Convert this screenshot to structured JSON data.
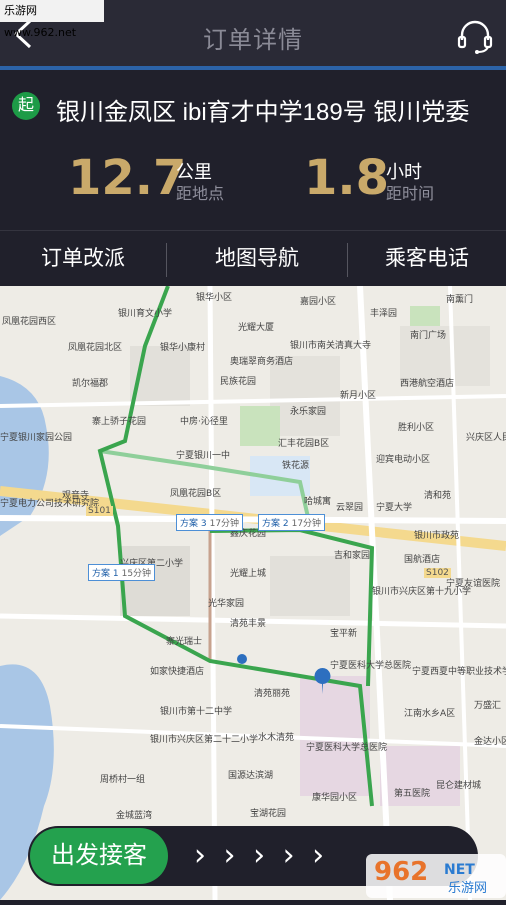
{
  "watermark_top": "乐游网 www.962.net",
  "header": {
    "title": "订单详情"
  },
  "order": {
    "start_badge": "起",
    "address": "银川金凤区 ibi育才中学189号 银川党委",
    "distance": {
      "value": "12.7",
      "unit": "公里",
      "label": "距地点"
    },
    "duration": {
      "value": "1.8",
      "unit": "小时",
      "label": "距时间"
    }
  },
  "actions": {
    "reassign": "订单改派",
    "navigate": "地图导航",
    "call": "乘客电话"
  },
  "map": {
    "labels": [
      "银华小区",
      "嘉园小区",
      "南薰门",
      "银川育文小学",
      "光耀大厦",
      "丰泽园",
      "凤凰花园西区",
      "凤凰花园北区",
      "银华小康村",
      "银川市南关清真大寺",
      "南门广场",
      "奥瑞翠商务酒店",
      "凯尔福郡",
      "民族花园",
      "西港航空酒店",
      "新月小区",
      "中房·沁径里",
      "永乐家园",
      "胜利小区",
      "寨上骄子花园",
      "汇丰花园B区",
      "宁夏银川一中",
      "兴庆区人民检察院",
      "宁夏银川家园公园",
      "铁花源",
      "迎宾电动小区",
      "清和苑",
      "宁夏电力公司技术研究院",
      "观音寺",
      "凤凰花园B区",
      "哈城寓",
      "云翠园",
      "宁夏大学",
      "银川市政苑",
      "国航酒店",
      "兴庆区第二小学",
      "吉和家园",
      "银川市兴庆区第十九小学",
      "光耀上城",
      "鑫庆花园",
      "宁夏友谊医院",
      "光华家园",
      "寨光瑞士",
      "清苑丰景",
      "宝平新",
      "如家快捷酒店",
      "宁夏医科大学总医院",
      "宁夏西夏中等职业技术学校",
      "清苑丽苑",
      "银川市第十二中学",
      "江南水乡A区",
      "万盛汇",
      "银川市兴庆区第二十二小学",
      "水木清苑",
      "宁夏医科大学总医院",
      "金达小区",
      "周桥村一组",
      "国源达滨湖",
      "金城蓝湾",
      "康华园小区",
      "第五医院",
      "宝湖花园",
      "昆仑建材城"
    ],
    "plans": [
      {
        "name": "方案 1",
        "time": "15分钟"
      },
      {
        "name": "方案 2",
        "time": "17分钟"
      },
      {
        "name": "方案 3",
        "time": "17分钟"
      }
    ],
    "road_labels": [
      "S101",
      "S102"
    ]
  },
  "bottom": {
    "depart": "出发接客",
    "arrows": "› › › › ›"
  },
  "logo": {
    "text": "962",
    "suffix": "NET",
    "sub": "乐游网"
  }
}
